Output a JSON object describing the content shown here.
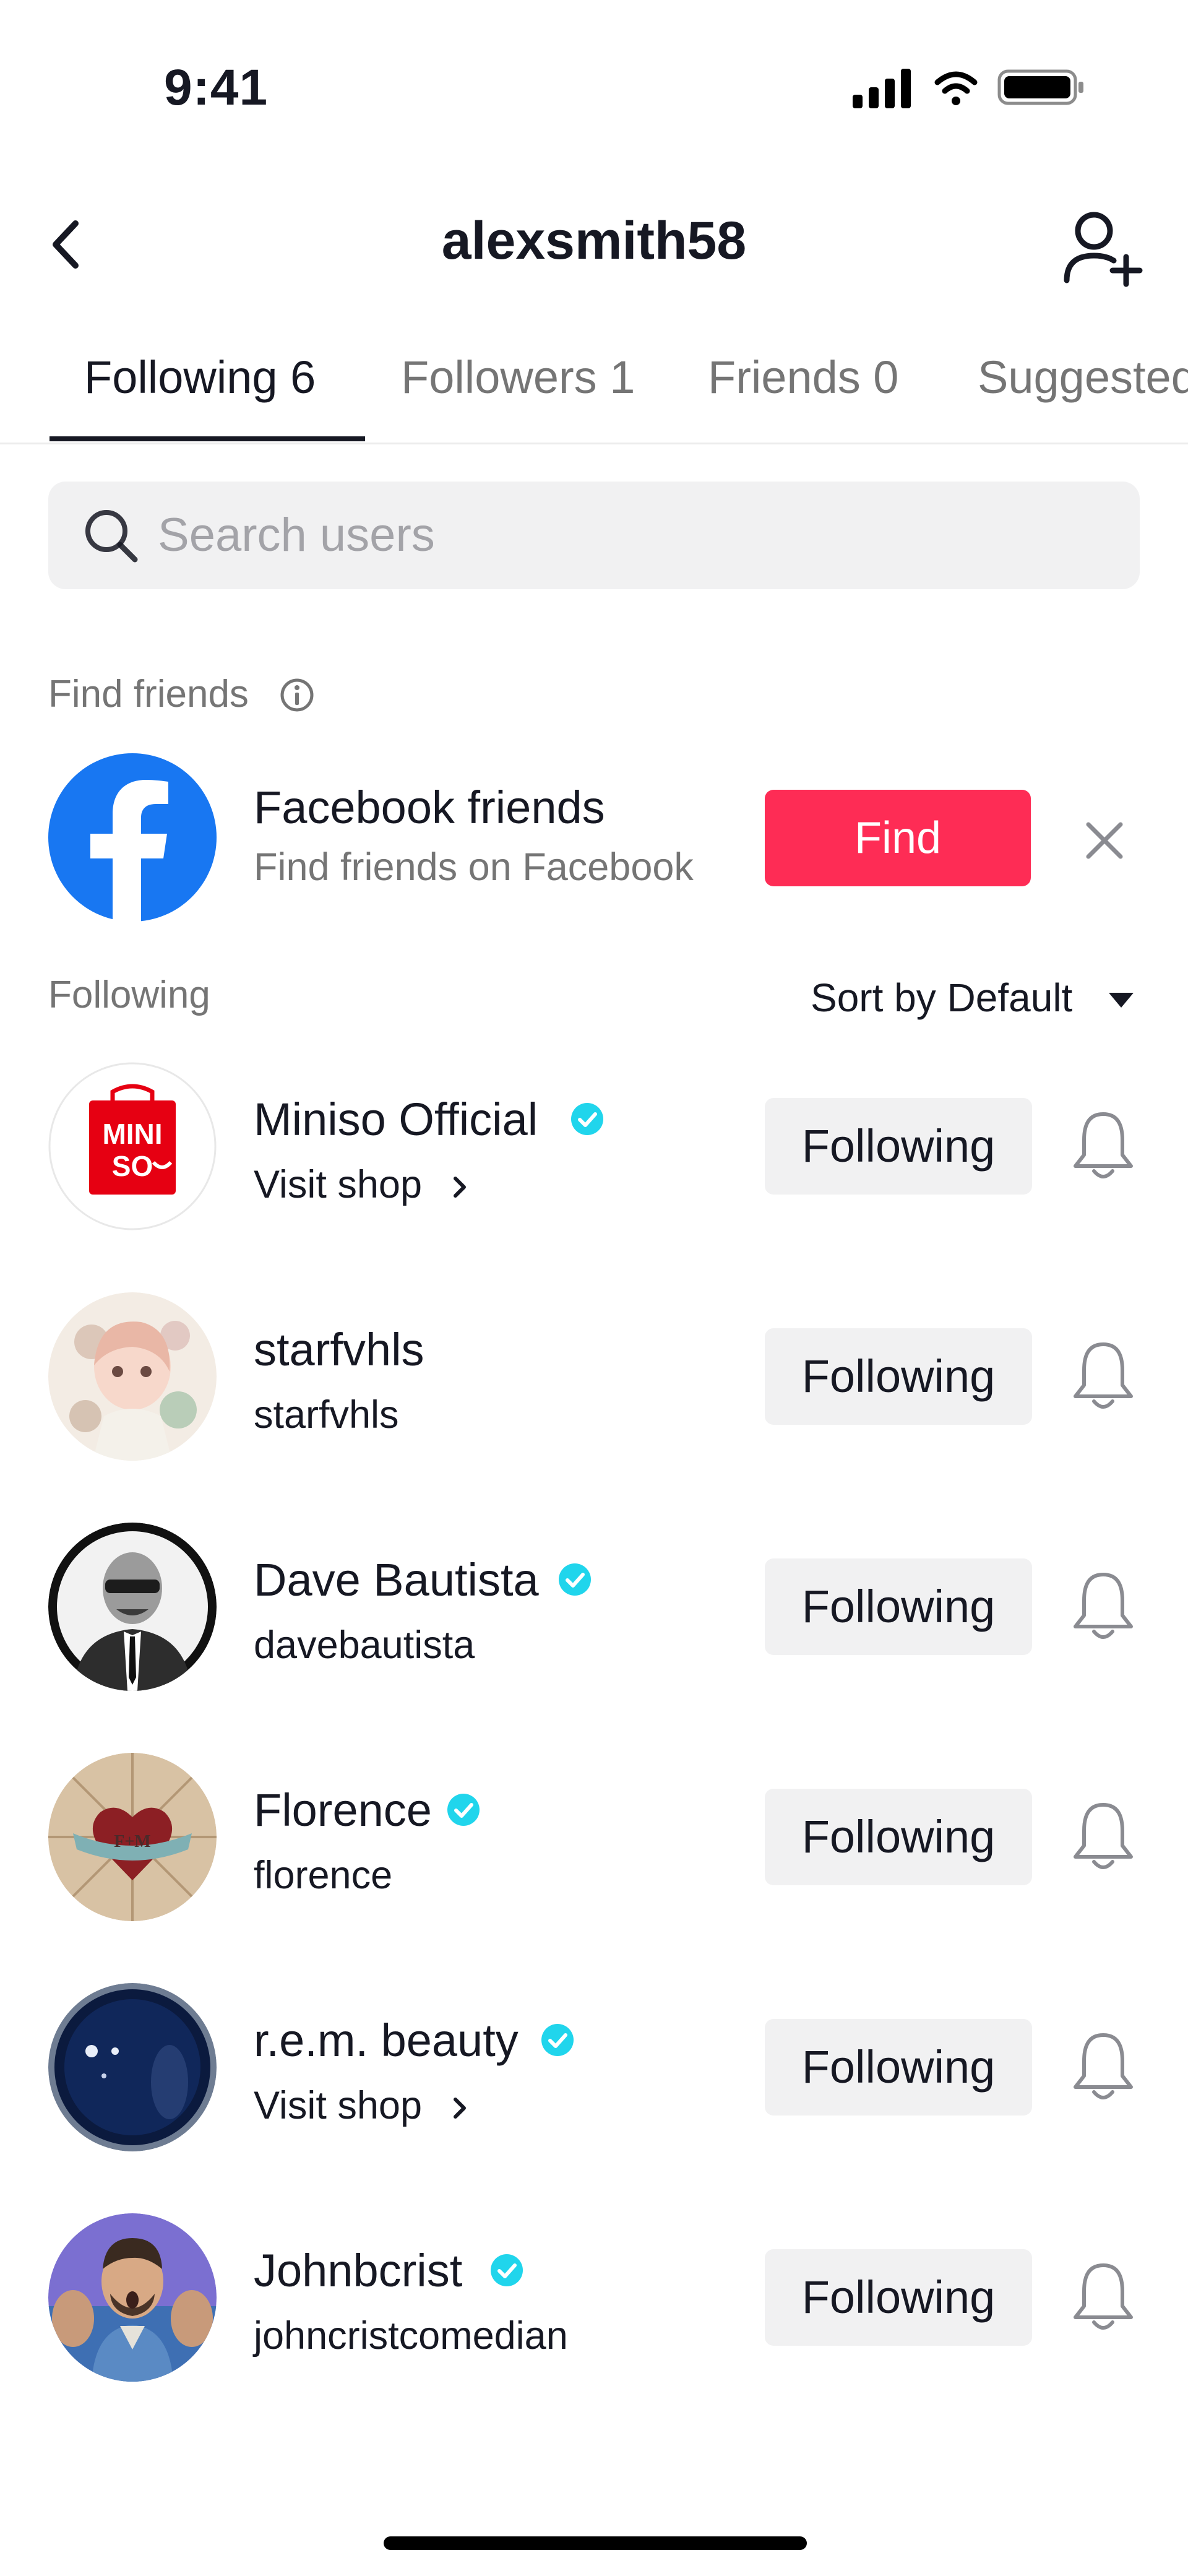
{
  "status_bar": {
    "time": "9:41"
  },
  "nav": {
    "title": "alexsmith58"
  },
  "tabs": [
    {
      "label": "Following 6",
      "active": true
    },
    {
      "label": "Followers 1",
      "active": false
    },
    {
      "label": "Friends 0",
      "active": false
    },
    {
      "label": "Suggested",
      "active": false
    }
  ],
  "search": {
    "placeholder": "Search users",
    "value": ""
  },
  "find_friends": {
    "label": "Find friends",
    "card": {
      "title": "Facebook friends",
      "subtitle": "Find friends on Facebook",
      "button": "Find"
    }
  },
  "following_section": {
    "label": "Following",
    "sort_label": "Sort by Default"
  },
  "users": [
    {
      "name": "Miniso Official",
      "verified": true,
      "sub": "Visit shop",
      "sub_is_link": true,
      "button": "Following",
      "avatar": "miniso-logo"
    },
    {
      "name": "starfvhls",
      "verified": false,
      "sub": "starfvhls",
      "sub_is_link": false,
      "button": "Following",
      "avatar": "illustration"
    },
    {
      "name": "Dave Bautista",
      "verified": true,
      "sub": "davebautista",
      "sub_is_link": false,
      "button": "Following",
      "avatar": "portrait-bw"
    },
    {
      "name": "Florence",
      "verified": true,
      "sub": "florence",
      "sub_is_link": false,
      "button": "Following",
      "avatar": "heart-art"
    },
    {
      "name": "r.e.m. beauty",
      "verified": true,
      "sub": "Visit shop",
      "sub_is_link": true,
      "button": "Following",
      "avatar": "dark-orb"
    },
    {
      "name": "Johnbcrist",
      "verified": true,
      "sub": "johncristcomedian",
      "sub_is_link": false,
      "button": "Following",
      "avatar": "portrait-color"
    }
  ],
  "colors": {
    "accent": "#fe2c55",
    "facebook": "#1877f2",
    "verified": "#20d5ec",
    "muted": "#757575"
  }
}
